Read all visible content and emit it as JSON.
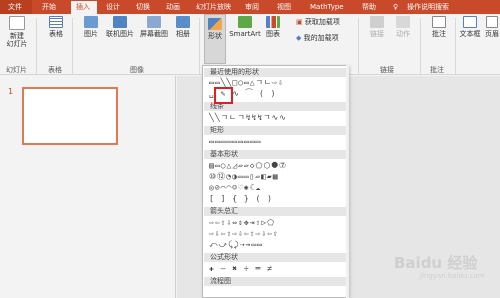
{
  "tabs": {
    "file": "文件",
    "start": "开始",
    "insert": "插入",
    "design": "设计",
    "transition": "切换",
    "animation": "动画",
    "slideshow": "幻灯片放映",
    "review": "审阅",
    "view": "视图",
    "mathtype": "MathType",
    "help": "帮助",
    "tell_me": "操作说明搜索"
  },
  "ribbon": {
    "new_slide": "新建\n幻灯片",
    "table": "表格",
    "picture": "图片",
    "online_picture": "联机图片",
    "screenshot": "屏幕截图",
    "album": "相册",
    "shapes": "形状",
    "smartart": "SmartArt",
    "chart": "图表",
    "get_addins": "获取加载项",
    "my_addins": "我的加载项",
    "link": "链接",
    "action": "动作",
    "comment": "批注",
    "textbox": "文本框",
    "header_footer": "页眉",
    "groups": {
      "slides": "幻灯片",
      "tables": "表格",
      "images": "图像",
      "links": "链接",
      "comments": "批注"
    }
  },
  "slides": {
    "number": "1"
  },
  "shapes_menu": {
    "sections": {
      "recent": "最近使用的形状",
      "lines": "线条",
      "rect": "矩形",
      "basic": "基本形状",
      "arrows": "箭头总汇",
      "equation": "公式形状",
      "flowchart": "流程图"
    },
    "rows": {
      "recent1": "▭▭╲╲□○▭△ㄱㄴ⇨⇩",
      "recent2": "␣ ✎ ∿ ⁀ ( )",
      "lines1": "╲╲ㄱㄴㄱ↯↯↯ㄱ∿∿",
      "rect1": "▭▭▭▭▭▭▭▭▭",
      "basic1": "▤▭○△◿▱▱◇⬠⬡⯃⑦",
      "basic2": "⑩⑫◔◑▭▭▯▱◧▰▦",
      "basic3": "◎⊘⌒◠☺♡✺☾☁ ",
      "basic4": "[ ] { } ( )",
      "arrows1": "⇨⇦⇧⇩⇔⇕✥⇥⇧▷⬠",
      "arrows2": "⇨⇩⇦⇧⇨⇩⇦⇧⇨⇩⇦⇧",
      "arrows3": "⤺⤻⤹⤸⇢⇝▭▭",
      "equation1": "✚ — ✖ ÷ ═ ≠",
      "watermark": "Baidu 经验",
      "watermark_sub": "jingyan.baidu.com"
    }
  }
}
